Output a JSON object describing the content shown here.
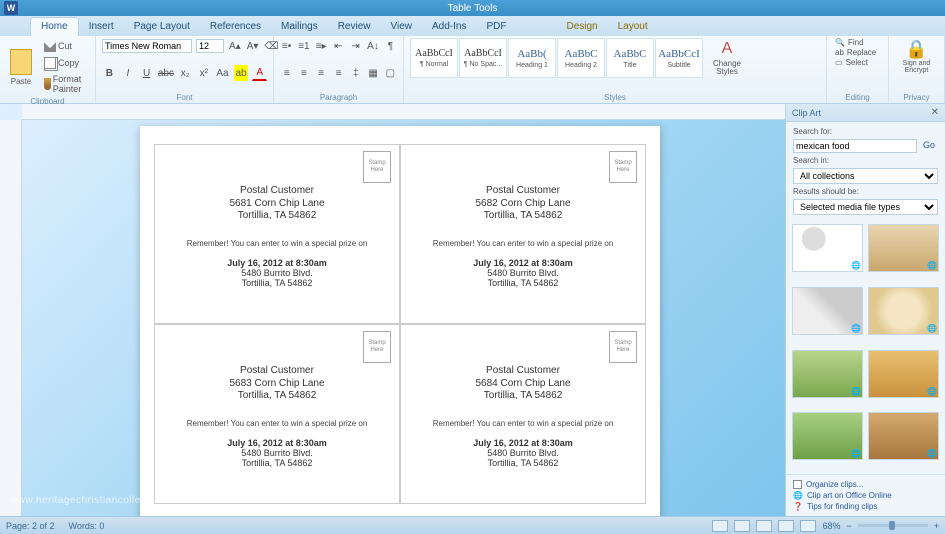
{
  "titlebar": {
    "contextual": "Table Tools"
  },
  "tabs": [
    "Home",
    "Insert",
    "Page Layout",
    "References",
    "Mailings",
    "Review",
    "View",
    "Add-Ins",
    "PDF",
    "Design",
    "Layout"
  ],
  "ribbon": {
    "clipboard": {
      "paste": "Paste",
      "cut": "Cut",
      "copy": "Copy",
      "painter": "Format Painter",
      "label": "Clipboard"
    },
    "font": {
      "name": "Times New Roman",
      "size": "12",
      "label": "Font"
    },
    "paragraph": {
      "label": "Paragraph"
    },
    "styles": {
      "items": [
        {
          "preview": "AaBbCcI",
          "label": "¶ Normal",
          "cls": "normal"
        },
        {
          "preview": "AaBbCcI",
          "label": "¶ No Spac...",
          "cls": "normal"
        },
        {
          "preview": "AaBb(",
          "label": "Heading 1",
          "cls": ""
        },
        {
          "preview": "AaBbC",
          "label": "Heading 2",
          "cls": ""
        },
        {
          "preview": "AaBbC",
          "label": "Title",
          "cls": ""
        },
        {
          "preview": "AaBbCcI",
          "label": "Subtitle",
          "cls": ""
        }
      ],
      "change": "Change Styles",
      "label": "Styles"
    },
    "editing": {
      "find": "Find",
      "replace": "Replace",
      "select": "Select",
      "label": "Editing"
    },
    "signing": {
      "sign": "Sign and Encrypt",
      "label": "Privacy"
    }
  },
  "cards": [
    {
      "name": "Postal Customer",
      "street": "5681 Corn Chip Lane",
      "city": "Tortillia, TA 54862"
    },
    {
      "name": "Postal Customer",
      "street": "5682 Corn Chip Lane",
      "city": "Tortillia, TA 54862"
    },
    {
      "name": "Postal Customer",
      "street": "5683 Corn Chip Lane",
      "city": "Tortillia, TA 54862"
    },
    {
      "name": "Postal Customer",
      "street": "5684 Corn Chip Lane",
      "city": "Tortillia, TA 54862"
    }
  ],
  "stamp": "Stamp Here",
  "remember": "Remember! You can enter to win a special prize on",
  "event": {
    "date": "July 16, 2012 at 8:30am",
    "addr": "5480 Burrito Blvd.",
    "city": "Tortillia, TA 54862"
  },
  "watermark": "www.heritagechristiancollege.com",
  "pane": {
    "title": "Clip Art",
    "search_for": "Search for:",
    "query": "mexican food",
    "go": "Go",
    "search_in": "Search in:",
    "collections": "All collections",
    "results_label": "Results should be:",
    "media_types": "Selected media file types",
    "organize": "Organize clips...",
    "online": "Clip art on Office Online",
    "tips": "Tips for finding clips"
  },
  "status": {
    "page": "Page: 2 of 2",
    "words": "Words: 0",
    "zoom": "68%"
  }
}
